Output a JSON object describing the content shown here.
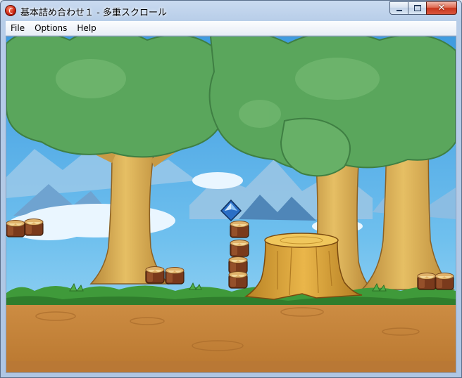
{
  "window": {
    "title": "基本詰め合わせ１ - 多重スクロール",
    "minimize_label": "",
    "maximize_label": "",
    "close_label": "✕"
  },
  "menu": {
    "items": [
      "File",
      "Options",
      "Help"
    ]
  },
  "scene": {
    "icons": [
      "tree-icon",
      "stump-icon",
      "log-block-icon",
      "gem-icon",
      "mountain-icon",
      "cloud-icon"
    ],
    "colors": {
      "sky": "#5fb4e8",
      "foliage": "#5aa65c",
      "trunk": "#d7ac55",
      "grass": "#3f9a3a",
      "dirt": "#c98a44",
      "gem": "#2a6ec6"
    }
  }
}
